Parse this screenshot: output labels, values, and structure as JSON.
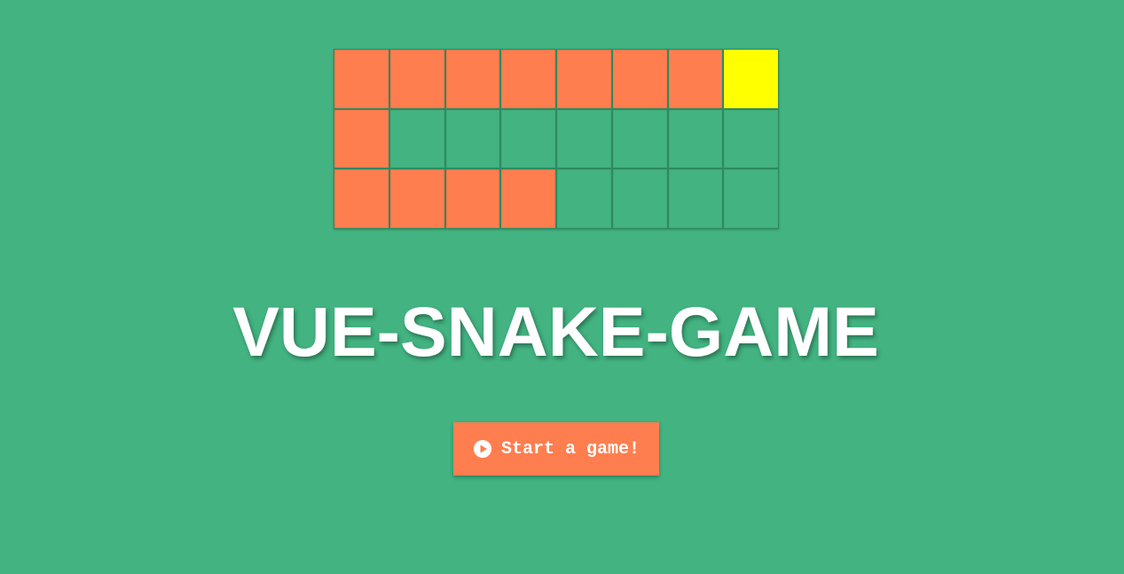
{
  "title": "VUE-SNAKE-GAME",
  "start_button": {
    "label": "Start a game!",
    "icon": "play-circle-icon"
  },
  "board": {
    "rows": 3,
    "cols": 8,
    "cells": [
      [
        "snake",
        "snake",
        "snake",
        "snake",
        "snake",
        "snake",
        "snake",
        "head"
      ],
      [
        "snake",
        "empty",
        "empty",
        "empty",
        "empty",
        "empty",
        "empty",
        "empty"
      ],
      [
        "snake",
        "snake",
        "snake",
        "snake",
        "empty",
        "empty",
        "empty",
        "empty"
      ]
    ]
  },
  "colors": {
    "background": "#42b381",
    "snake": "#ff7e50",
    "head": "#ffff00",
    "button": "#ff7e50",
    "text": "#ffffff"
  }
}
